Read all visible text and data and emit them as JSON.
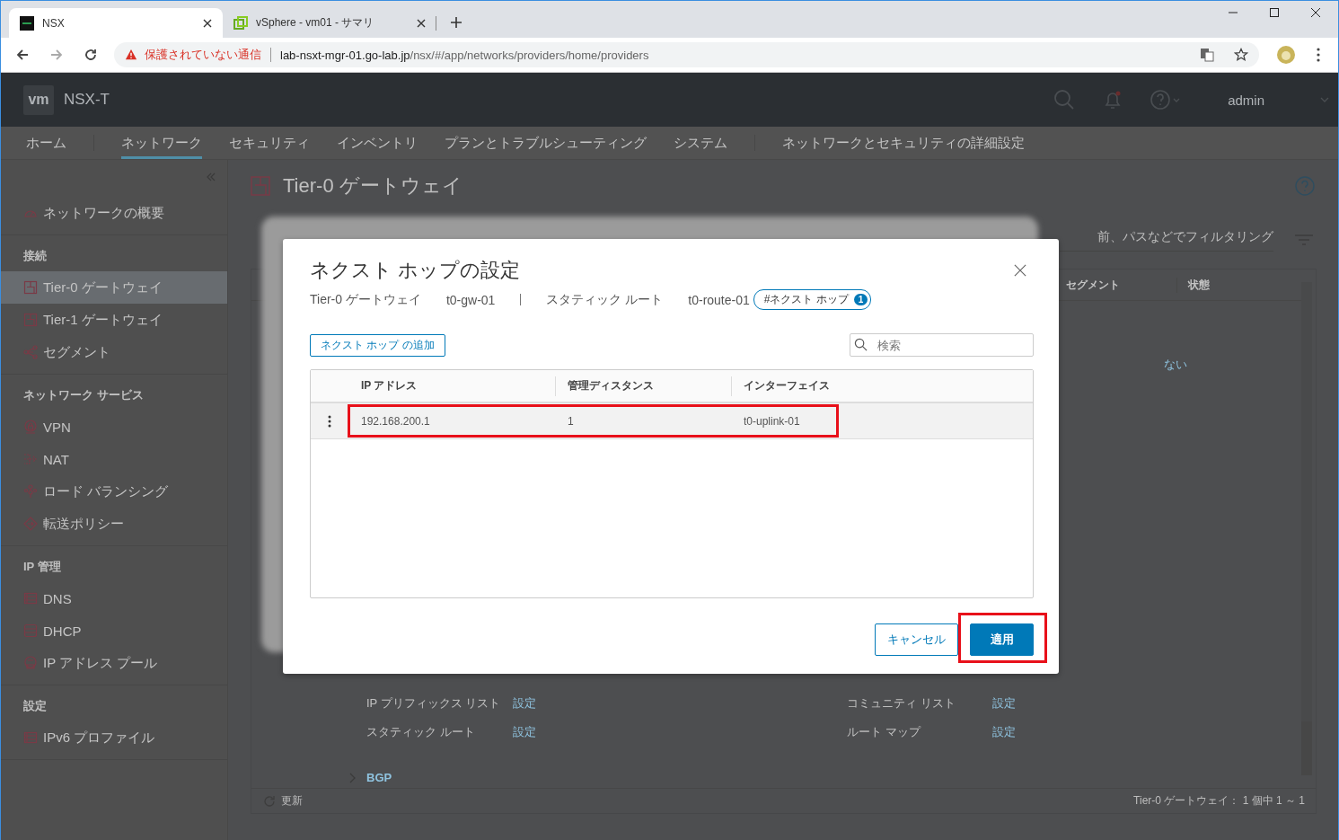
{
  "browser": {
    "tabs": [
      {
        "title": "NSX",
        "kind": "nsx",
        "selected": true
      },
      {
        "title": "vSphere - vm01 - サマリ",
        "kind": "vsphere",
        "selected": false
      }
    ],
    "security_text": "保護されていない通信",
    "url_host": "lab-nsxt-mgr-01.go-lab.jp",
    "url_path": "/nsx/#/app/networks/providers/home/providers"
  },
  "header": {
    "logo": "vm",
    "product": "NSX-T",
    "user": "admin"
  },
  "nav_groups": [
    [
      {
        "label": "ホーム",
        "selected": false
      }
    ],
    [
      {
        "label": "ネットワーク",
        "selected": true
      },
      {
        "label": "セキュリティ",
        "selected": false
      },
      {
        "label": "インベントリ",
        "selected": false
      },
      {
        "label": "プランとトラブルシューティング",
        "selected": false
      },
      {
        "label": "システム",
        "selected": false
      }
    ],
    [
      {
        "label": "ネットワークとセキュリティの詳細設定",
        "selected": false
      }
    ]
  ],
  "sidebar": [
    {
      "items": [
        {
          "label": "ネットワークの概要",
          "kind": "overview",
          "selected": false
        }
      ]
    },
    {
      "heading": "接続",
      "items": [
        {
          "label": "Tier-0 ゲートウェイ",
          "kind": "gateway",
          "selected": true
        },
        {
          "label": "Tier-1 ゲートウェイ",
          "kind": "gateway",
          "selected": false
        },
        {
          "label": "セグメント",
          "kind": "segment",
          "selected": false
        }
      ]
    },
    {
      "heading": "ネットワーク サービス",
      "items": [
        {
          "label": "VPN",
          "kind": "vpn",
          "selected": false
        },
        {
          "label": "NAT",
          "kind": "nat",
          "selected": false
        },
        {
          "label": "ロード バランシング",
          "kind": "lb",
          "selected": false
        },
        {
          "label": "転送ポリシー",
          "kind": "policy",
          "selected": false
        }
      ]
    },
    {
      "heading": "IP 管理",
      "items": [
        {
          "label": "DNS",
          "kind": "server",
          "selected": false
        },
        {
          "label": "DHCP",
          "kind": "stack",
          "selected": false
        },
        {
          "label": "IP アドレス プール",
          "kind": "pool",
          "selected": false
        }
      ]
    },
    {
      "heading": "設定",
      "items": [
        {
          "label": "IPv6 プロファイル",
          "kind": "server",
          "selected": false
        }
      ]
    }
  ],
  "page": {
    "title": "Tier-0 ゲートウェイ",
    "filter_placeholder": "前、パスなどでフィルタリング",
    "columns": [
      "セグメント",
      "状態"
    ],
    "link": "ない",
    "routing_rows": [
      [
        {
          "label": "IP プリフィックス リスト",
          "action": "設定"
        },
        {
          "label": "コミュニティ リスト",
          "action": "設定"
        }
      ],
      [
        {
          "label": "スタティック ルート",
          "action": "設定"
        },
        {
          "label": "ルート マップ",
          "action": "設定"
        }
      ]
    ],
    "section": "BGP",
    "refresh": "更新",
    "footer_count": "Tier-0 ゲートウェイ： 1 個中 1 ～ 1"
  },
  "dialog": {
    "title": "ネクスト ホップの設定",
    "breadcrumb": [
      {
        "type": "Tier-0 ゲートウェイ",
        "name": "t0-gw-01"
      },
      {
        "type": "スタティック ルート",
        "name": "t0-route-01"
      }
    ],
    "badge": {
      "label": "#ネクスト ホップ",
      "count": "1"
    },
    "add_button": "ネクスト ホップ の追加",
    "search_placeholder": "検索",
    "columns": [
      "IP アドレス",
      "管理ディスタンス",
      "インターフェイス"
    ],
    "rows": [
      {
        "cells": [
          "192.168.200.1",
          "1",
          "t0-uplink-01"
        ],
        "selected": true,
        "highlighted": true
      }
    ],
    "buttons": [
      {
        "label": "キャンセル",
        "kind": "secondary",
        "highlighted": false
      },
      {
        "label": "適用",
        "kind": "primary",
        "highlighted": true
      }
    ]
  }
}
